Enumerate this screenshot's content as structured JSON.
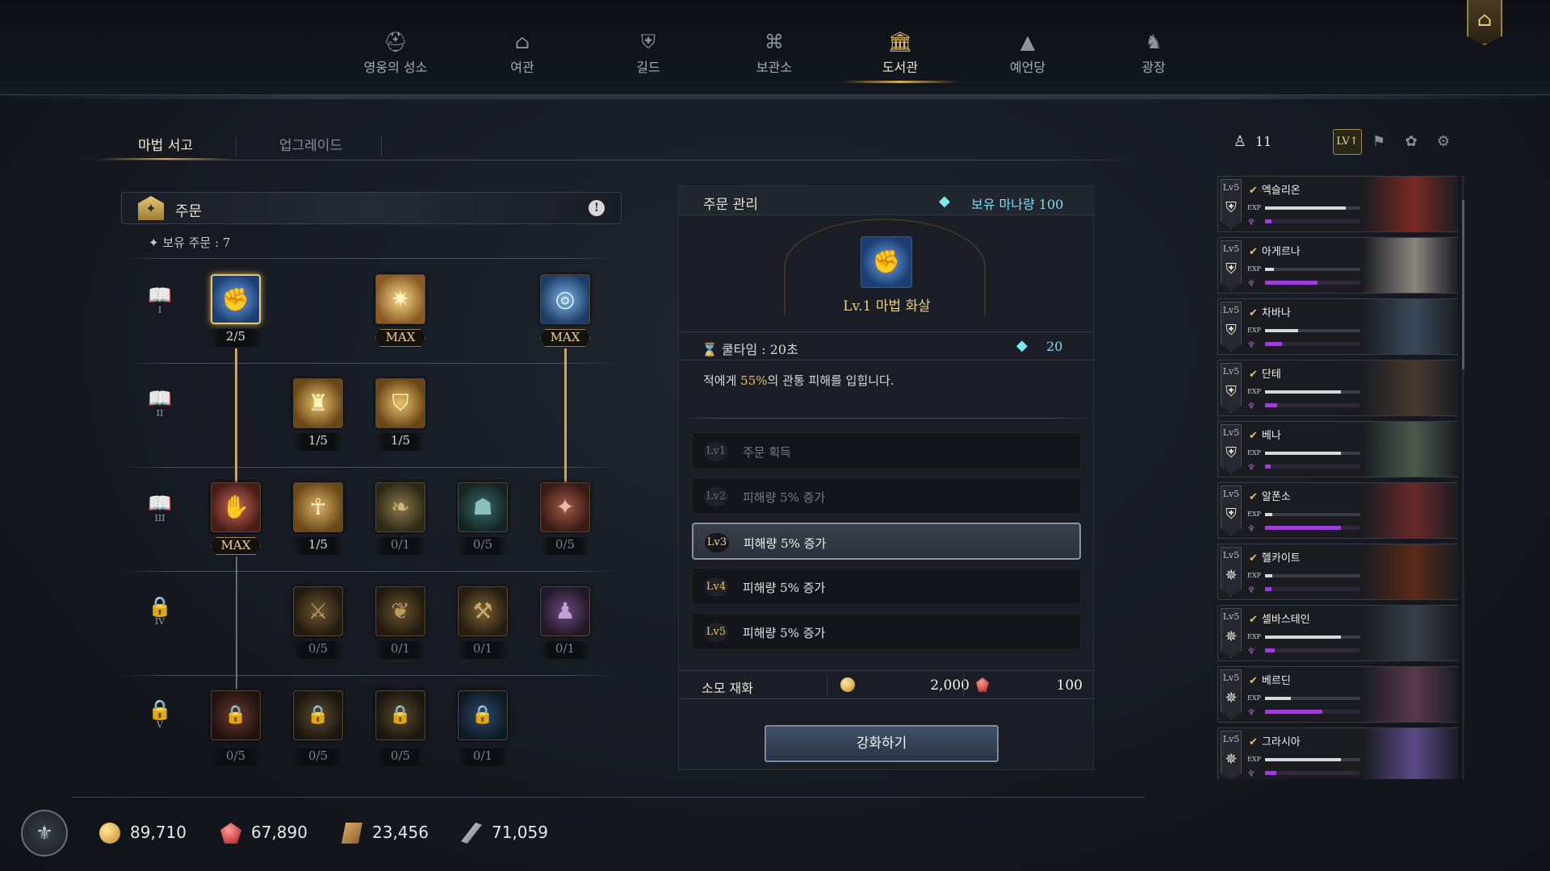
{
  "nav": [
    {
      "label": "영웅의 성소",
      "icon": "helmet-icon"
    },
    {
      "label": "여관",
      "icon": "tavern-icon"
    },
    {
      "label": "길드",
      "icon": "shield-icon"
    },
    {
      "label": "보관소",
      "icon": "vault-icon"
    },
    {
      "label": "도서관",
      "icon": "library-icon",
      "active": true
    },
    {
      "label": "예언당",
      "icon": "witch-hat-icon"
    },
    {
      "label": "광장",
      "icon": "dragon-icon"
    }
  ],
  "subtabs": {
    "spellbook": "마법 서고",
    "upgrade": "업그레이드"
  },
  "spells": {
    "header": "주문",
    "owned": "✦ 보유 주문 : 7",
    "tiers": [
      "I",
      "II",
      "III",
      "IV",
      "V"
    ],
    "rows": [
      [
        "2/5",
        "MAX",
        "MAX"
      ],
      [
        "1/5",
        "1/5"
      ],
      [
        "MAX",
        "1/5",
        "0/1",
        "0/5",
        "0/5"
      ],
      [
        "0/5",
        "0/1",
        "0/1",
        "0/1"
      ],
      [
        "0/5",
        "0/5",
        "0/5",
        "0/1"
      ]
    ]
  },
  "mgmt": {
    "title": "주문 관리",
    "mana_label": "보유 마나량 100",
    "spell_name": "Lv.1 마법 화살",
    "cooldown": "쿨타임 : 20초",
    "mana_cost": "20",
    "desc_pre": "적에게 ",
    "desc_hl": "55%",
    "desc_post": "의 관통 피해를 입힙니다.",
    "levels": [
      {
        "lv": "Lv1",
        "text": "주문 획득",
        "state": "done"
      },
      {
        "lv": "Lv2",
        "text": "피해량 5% 증가",
        "state": "done"
      },
      {
        "lv": "Lv3",
        "text": "피해량 5% 증가",
        "state": "cur"
      },
      {
        "lv": "Lv4",
        "text": "피해량 5% 증가",
        "state": "next"
      },
      {
        "lv": "Lv5",
        "text": "피해량 5% 증가",
        "state": "next"
      }
    ],
    "cost_label": "소모 재화",
    "gold_cost": "2,000",
    "ruby_cost": "100",
    "upgrade_button": "강화하기"
  },
  "hero_panel": {
    "count": "11",
    "sort_label": "LV↑"
  },
  "heroes": [
    {
      "lv": "Lv5",
      "name": "엑슬리온",
      "exp": 0.85,
      "mana": 0.07,
      "color": "#7a2a22"
    },
    {
      "lv": "Lv5",
      "name": "아게르나",
      "exp": 0.09,
      "mana": 0.55,
      "color": "#8a8680"
    },
    {
      "lv": "Lv5",
      "name": "차바나",
      "exp": 0.35,
      "mana": 0.18,
      "color": "#3a4a5a"
    },
    {
      "lv": "Lv5",
      "name": "단테",
      "exp": 0.8,
      "mana": 0.13,
      "color": "#4a3a30"
    },
    {
      "lv": "Lv5",
      "name": "베나",
      "exp": 0.8,
      "mana": 0.06,
      "color": "#4e5a4c"
    },
    {
      "lv": "Lv5",
      "name": "알폰소",
      "exp": 0.08,
      "mana": 0.8,
      "color": "#6a2a2a"
    },
    {
      "lv": "Lv5",
      "name": "헬카이트",
      "exp": 0.08,
      "mana": 0.07,
      "color": "#5a2a18"
    },
    {
      "lv": "Lv5",
      "name": "셀바스테인",
      "exp": 0.8,
      "mana": 0.1,
      "color": "#3a3e48"
    },
    {
      "lv": "Lv5",
      "name": "베르딘",
      "exp": 0.27,
      "mana": 0.6,
      "color": "#5a3a4a"
    },
    {
      "lv": "Lv5",
      "name": "그라시아",
      "exp": 0.8,
      "mana": 0.12,
      "color": "#5a4a8a"
    }
  ],
  "resources": [
    {
      "icon": "gold-coin-icon",
      "value": "89,710"
    },
    {
      "icon": "ruby-icon",
      "value": "67,890"
    },
    {
      "icon": "scroll-icon",
      "value": "23,456"
    },
    {
      "icon": "feather-icon",
      "value": "71,059"
    }
  ]
}
